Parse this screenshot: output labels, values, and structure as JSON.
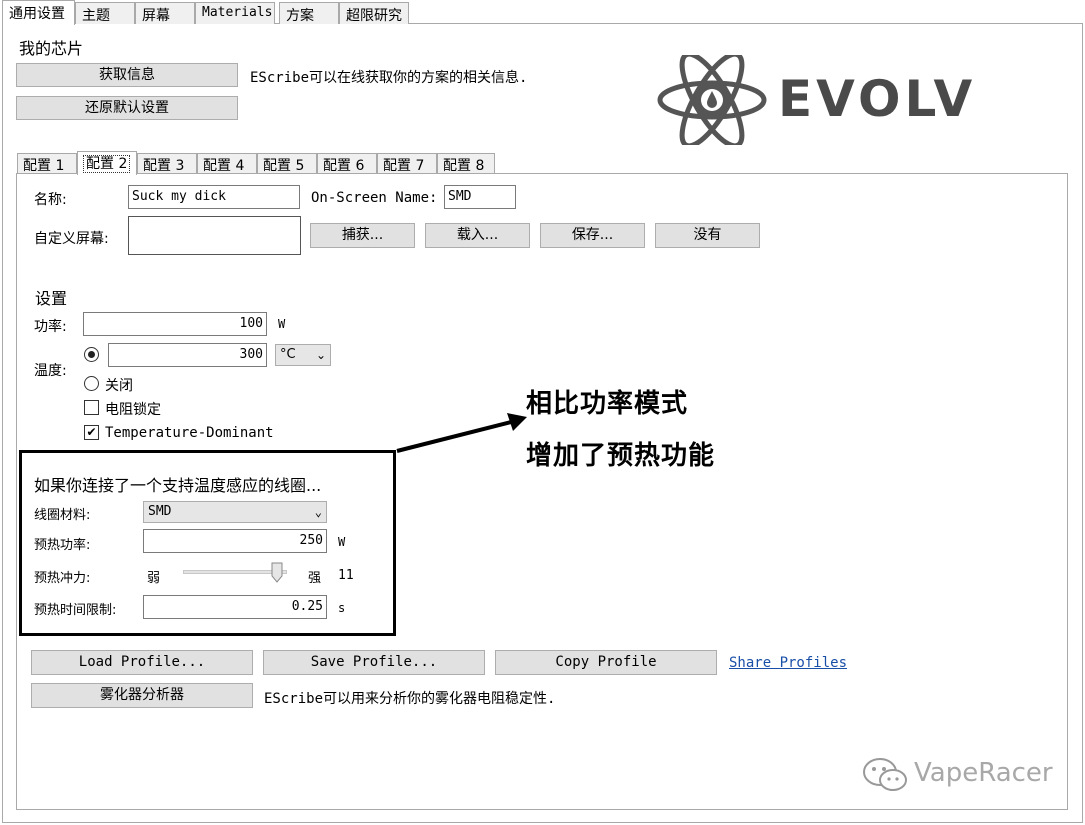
{
  "top_tabs": [
    "通用设置",
    "主题",
    "屏幕",
    "Materials",
    "方案",
    "超限研究"
  ],
  "chip": {
    "title": "我的芯片",
    "get_info_button": "获取信息",
    "restore_button": "还原默认设置",
    "info_text": "EScribe可以在线获取你的方案的相关信息."
  },
  "logo_text": "EVOLV",
  "profile_tabs": [
    "配置 1",
    "配置 2",
    "配置 3",
    "配置 4",
    "配置 5",
    "配置 6",
    "配置 7",
    "配置 8"
  ],
  "profile": {
    "name_label": "名称:",
    "name_value": "Suck my dick",
    "onscreen_label": "On-Screen Name:",
    "onscreen_value": "SMD",
    "custom_screen_label": "自定义屏幕:",
    "capture_button": "捕获...",
    "load_button": "载入...",
    "save_button": "保存...",
    "none_button": "没有"
  },
  "settings": {
    "title": "设置",
    "power_label": "功率:",
    "power_value": "100",
    "power_unit": "W",
    "temp_label": "温度:",
    "temp_value": "300",
    "temp_unit": "°C",
    "off_label": "关闭",
    "resistance_lock_label": "电阻锁定",
    "temp_dominant_label": "Temperature-Dominant"
  },
  "preheat": {
    "title": "如果你连接了一个支持温度感应的线圈...",
    "material_label": "线圈材料:",
    "material_value": "SMD",
    "power_label": "预热功率:",
    "power_value": "250",
    "power_unit": "W",
    "punch_label": "预热冲力:",
    "punch_weak": "弱",
    "punch_strong": "强",
    "punch_value": "11",
    "punch_fraction": 0.97,
    "time_label": "预热时间限制:",
    "time_value": "0.25",
    "time_unit": "s"
  },
  "profile_actions": {
    "load": "Load Profile...",
    "save": "Save Profile...",
    "copy": "Copy Profile",
    "share": "Share Profiles",
    "analyzer": "雾化器分析器",
    "analyzer_text": "EScribe可以用来分析你的雾化器电阻稳定性."
  },
  "annotation": {
    "line1": "相比功率模式",
    "line2": "增加了预热功能"
  },
  "watermark": "VapeRacer"
}
